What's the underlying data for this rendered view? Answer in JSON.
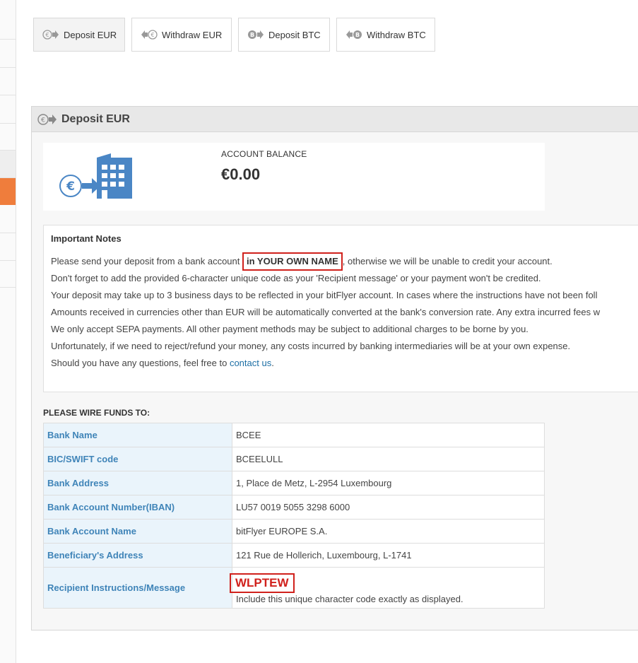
{
  "tabs": [
    {
      "label": "Deposit EUR",
      "icon": "euro-deposit-icon"
    },
    {
      "label": "Withdraw EUR",
      "icon": "euro-withdraw-icon"
    },
    {
      "label": "Deposit BTC",
      "icon": "bitcoin-deposit-icon"
    },
    {
      "label": "Withdraw BTC",
      "icon": "bitcoin-withdraw-icon"
    }
  ],
  "panel": {
    "title": "Deposit EUR",
    "balance_label": "ACCOUNT BALANCE",
    "balance_value": "€0.00"
  },
  "notes": {
    "title": "Important Notes",
    "line1_pre": "Please send your deposit from a bank account ",
    "line1_emph": "in YOUR OWN NAME",
    "line1_post": ", otherwise we will be unable to credit your account.",
    "line2": "Don't forget to add the provided 6-character unique code as your 'Recipient message' or your payment won't be credited.",
    "line3": "Your deposit may take up to 3 business days to be reflected in your bitFlyer account. In cases where the instructions have not been foll",
    "line4": "Amounts received in currencies other than EUR will be automatically converted at the bank's conversion rate. Any extra incurred fees w",
    "line5": "We only accept SEPA payments. All other payment methods may be subject to additional charges to be borne by you.",
    "line6": "Unfortunately, if we need to reject/refund your money, any costs incurred by banking intermediaries will be at your own expense.",
    "line7_pre": "Should you have any questions, feel free to ",
    "line7_link": "contact us",
    "line7_post": "."
  },
  "wire": {
    "title": "PLEASE WIRE FUNDS TO:",
    "rows": [
      {
        "label": "Bank Name",
        "value": "BCEE"
      },
      {
        "label": "BIC/SWIFT code",
        "value": "BCEELULL"
      },
      {
        "label": "Bank Address",
        "value": "1, Place de Metz, L-2954 Luxembourg"
      },
      {
        "label": "Bank Account Number(IBAN)",
        "value": "LU57 0019 5055 3298 6000"
      },
      {
        "label": "Bank Account Name",
        "value": "bitFlyer EUROPE S.A."
      },
      {
        "label": "Beneficiary's Address",
        "value": "121 Rue de Hollerich, Luxembourg, L-1741"
      }
    ],
    "recipient_label": "Recipient Instructions/Message",
    "recipient_code": "WLPTEW",
    "recipient_note": "Include this unique character code exactly as displayed."
  },
  "colors": {
    "accent": "#ef7d3c",
    "link": "#1d6fa5",
    "key_text": "#3f84b8",
    "highlight": "#d0211c",
    "icon_blue": "#4a86c5"
  }
}
